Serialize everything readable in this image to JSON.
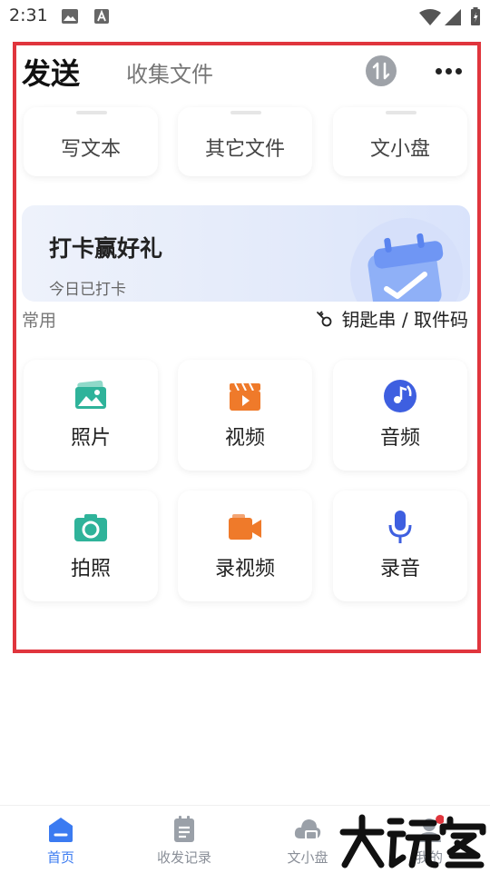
{
  "status_bar": {
    "time": "2:31"
  },
  "header": {
    "send_tab": "发送",
    "collect_tab": "收集文件"
  },
  "top_actions": [
    {
      "label": "写文本"
    },
    {
      "label": "其它文件"
    },
    {
      "label": "文小盘"
    }
  ],
  "banner": {
    "title": "打卡赢好礼",
    "subtitle": "今日已打卡"
  },
  "section": {
    "common": "常用",
    "keychain": "钥匙串 / 取件码"
  },
  "grid": [
    {
      "label": "照片",
      "icon": "photo-icon",
      "color": "#2fb39a"
    },
    {
      "label": "视频",
      "icon": "video-icon",
      "color": "#ef7a2a"
    },
    {
      "label": "音频",
      "icon": "audio-icon",
      "color": "#3e5fe0"
    },
    {
      "label": "拍照",
      "icon": "camera-icon",
      "color": "#2fb39a"
    },
    {
      "label": "录视频",
      "icon": "record-video-icon",
      "color": "#ef7a2a"
    },
    {
      "label": "录音",
      "icon": "microphone-icon",
      "color": "#3e5fe0"
    }
  ],
  "bottom_nav": [
    {
      "label": "首页",
      "icon": "home-icon",
      "active": true
    },
    {
      "label": "收发记录",
      "icon": "records-icon",
      "active": false
    },
    {
      "label": "文小盘",
      "icon": "cloud-drive-icon",
      "active": false
    },
    {
      "label": "我的",
      "icon": "profile-icon",
      "active": false
    }
  ],
  "watermark": {
    "text": "大玩家"
  },
  "colors": {
    "accent": "#3b7bf1",
    "frame": "#e0353d",
    "teal": "#2fb39a",
    "orange": "#ef7a2a",
    "blue": "#3e5fe0"
  }
}
